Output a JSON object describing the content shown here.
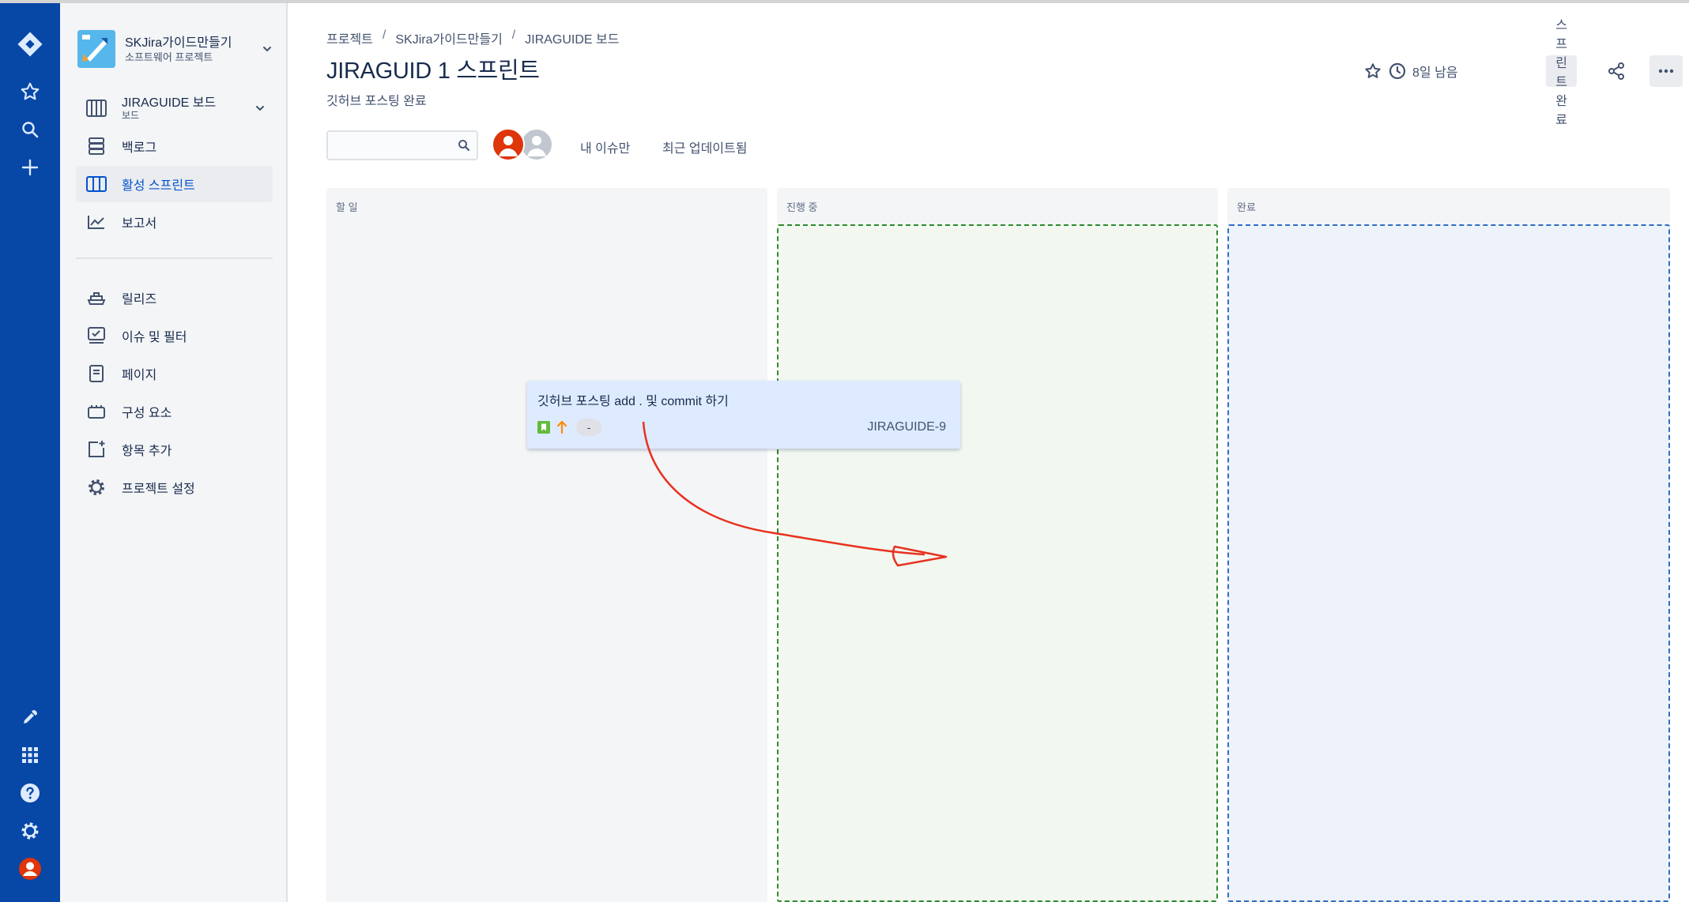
{
  "project": {
    "name": "SKJira가이드만들기",
    "type": "소프트웨어 프로젝트"
  },
  "board_switcher": {
    "name": "JIRAGUIDE 보드",
    "type": "보드"
  },
  "sidebar": {
    "items": [
      {
        "label": "백로그",
        "icon": "backlog-icon"
      },
      {
        "label": "활성 스프린트",
        "icon": "board-icon",
        "active": true
      },
      {
        "label": "보고서",
        "icon": "reports-icon"
      },
      {
        "label": "릴리즈",
        "icon": "releases-icon"
      },
      {
        "label": "이슈 및 필터",
        "icon": "issues-icon"
      },
      {
        "label": "페이지",
        "icon": "page-icon"
      },
      {
        "label": "구성 요소",
        "icon": "components-icon"
      },
      {
        "label": "항목 추가",
        "icon": "add-item-icon"
      },
      {
        "label": "프로젝트 설정",
        "icon": "settings-icon"
      }
    ]
  },
  "breadcrumb": [
    "프로젝트",
    "SKJira가이드만들기",
    "JIRAGUIDE 보드"
  ],
  "sprint": {
    "title": "JIRAGUID 1 스프린트",
    "goal": "깃허브 포스팅 완료",
    "days_left": "8일 남음",
    "complete_label": "스프린트 완료"
  },
  "search": {
    "placeholder": "",
    "value": ""
  },
  "quick_filters": [
    "내 이슈만",
    "최근 업데이트됨"
  ],
  "columns": [
    {
      "title": "할 일"
    },
    {
      "title": "진행 중"
    },
    {
      "title": "완료"
    }
  ],
  "card": {
    "title": "깃허브 포스팅 add . 및 commit 하기",
    "estimate": "-",
    "key": "JIRAGUIDE-9",
    "type_icon": "story-icon",
    "priority_icon": "priority-high-icon"
  },
  "colors": {
    "global_nav": "#0747A6",
    "card": "#DEEBFF",
    "arrow": "#E8311F"
  }
}
